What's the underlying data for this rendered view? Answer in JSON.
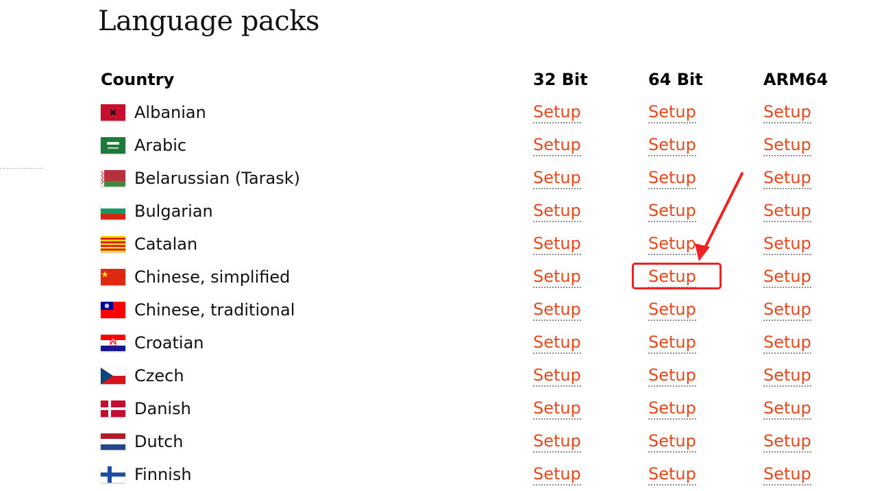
{
  "page": {
    "title": "Language packs"
  },
  "table": {
    "headers": {
      "country": "Country",
      "bit32": "32 Bit",
      "bit64": "64 Bit",
      "arm64": "ARM64"
    },
    "link_label": "Setup",
    "rows": [
      {
        "name": "Albanian",
        "flag": "albania-flag-icon"
      },
      {
        "name": "Arabic",
        "flag": "saudi-arabia-flag-icon"
      },
      {
        "name": "Belarussian (Tarask)",
        "flag": "belarus-flag-icon"
      },
      {
        "name": "Bulgarian",
        "flag": "bulgaria-flag-icon"
      },
      {
        "name": "Catalan",
        "flag": "catalonia-flag-icon"
      },
      {
        "name": "Chinese, simplified",
        "flag": "china-flag-icon"
      },
      {
        "name": "Chinese, traditional",
        "flag": "taiwan-flag-icon"
      },
      {
        "name": "Croatian",
        "flag": "croatia-flag-icon"
      },
      {
        "name": "Czech",
        "flag": "czech-flag-icon"
      },
      {
        "name": "Danish",
        "flag": "denmark-flag-icon"
      },
      {
        "name": "Dutch",
        "flag": "netherlands-flag-icon"
      },
      {
        "name": "Finnish",
        "flag": "finland-flag-icon"
      }
    ]
  },
  "annotation": {
    "highlighted_row": "Chinese, simplified",
    "highlighted_column": "64 Bit",
    "color": "#ee2222"
  },
  "colors": {
    "link": "#e8481c",
    "text": "#111111"
  }
}
